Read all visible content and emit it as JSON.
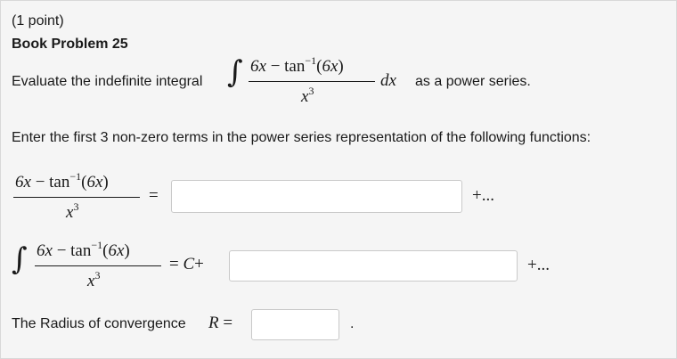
{
  "header": {
    "points": "(1 point)",
    "title": "Book Problem 25"
  },
  "problem": {
    "evaluate_prefix": "Evaluate the indefinite integral",
    "evaluate_suffix": "as a power series.",
    "integrand_num": "6x − tan⁻¹(6x)",
    "integrand_den": "x³",
    "dx": "dx",
    "instruction": "Enter the first 3 non-zero terms in the power series representation of the following functions:"
  },
  "rows": {
    "series_continuation": "+...",
    "equals": "=",
    "constant_prefix": "= C+",
    "radius_label": "The Radius of convergence",
    "radius_var": "R",
    "radius_period": "."
  },
  "inputs": {
    "series_answer": "",
    "integral_answer": "",
    "radius_answer": ""
  }
}
